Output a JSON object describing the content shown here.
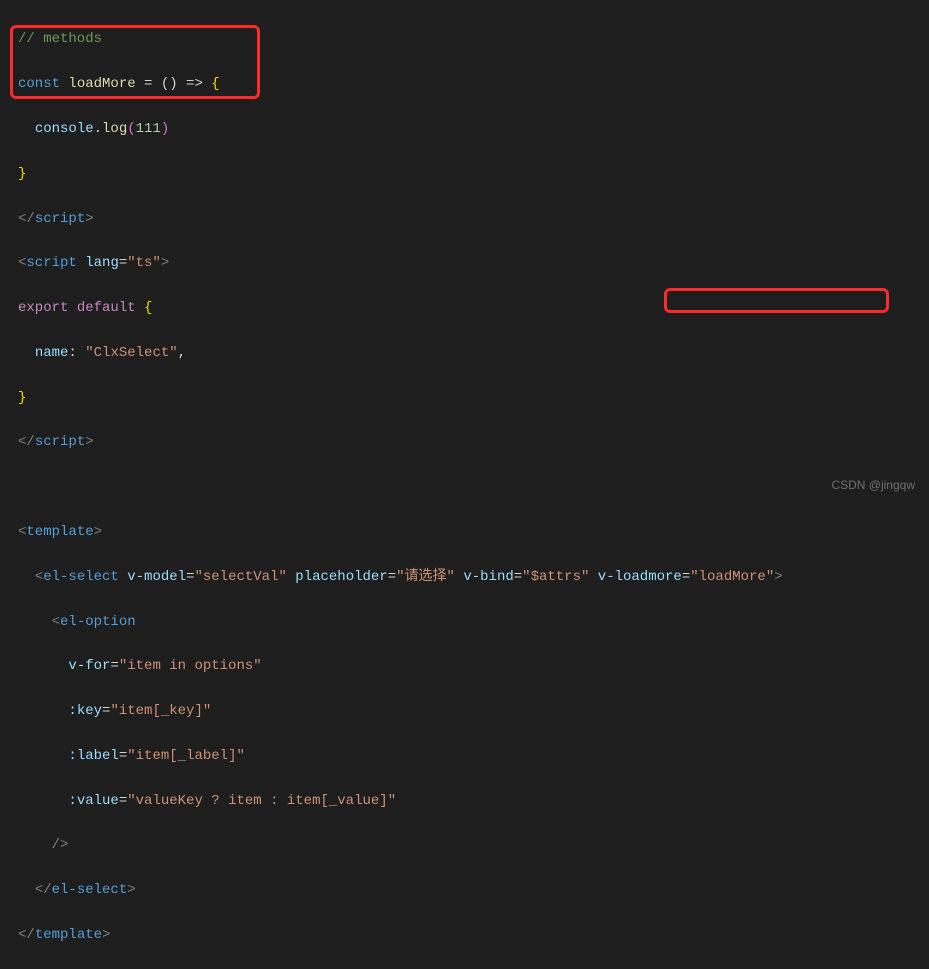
{
  "watermark": "CSDN @jingqw",
  "code": {
    "l1_comment": "// methods",
    "l2_const": "const",
    "l2_name": "loadMore",
    "l2_arrow": " = () => ",
    "l3_indent": "  ",
    "l3_console": "console",
    "l3_log": "log",
    "l3_arg": "111",
    "l5_close_script": "script",
    "l6_open_script": "script",
    "l6_lang_attr": "lang",
    "l6_lang_val": "\"ts\"",
    "l7_export": "export",
    "l7_default": "default",
    "l8_name_key": "name",
    "l8_name_val": "\"ClxSelect\"",
    "l12_template": "template",
    "l13_elselect": "el-select",
    "l13_vmodel": "v-model",
    "l13_vmodel_val": "\"selectVal\"",
    "l13_placeholder": "placeholder",
    "l13_placeholder_val": "\"请选择\"",
    "l13_vbind": "v-bind",
    "l13_vbind_val": "\"$attrs\"",
    "l13_vloadmore": "v-loadmore",
    "l13_vloadmore_val": "\"loadMore\"",
    "l14_eloption": "el-option",
    "l15_vfor": "v-for",
    "l15_vfor_val": "\"item in options\"",
    "l16_key": ":key",
    "l16_key_val": "\"item[_key]\"",
    "l17_label": ":label",
    "l17_label_val": "\"item[_label]\"",
    "l18_value": ":value",
    "l18_value_val": "\"valueKey ? item : item[_value]\""
  }
}
